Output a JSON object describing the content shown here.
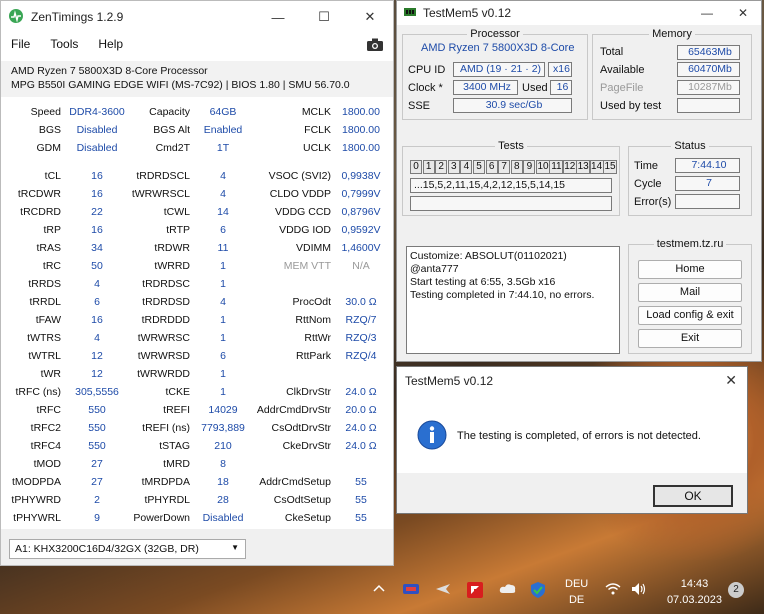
{
  "zen": {
    "title": "ZenTimings 1.2.9",
    "menu": [
      "File",
      "Tools",
      "Help"
    ],
    "cpu": "AMD Ryzen 7 5800X3D 8-Core Processor",
    "board": "MPG B550I GAMING EDGE WIFI (MS-7C92) | BIOS 1.80 | SMU 56.70.0",
    "rows": [
      [
        "Speed",
        "DDR4-3600",
        "Capacity",
        "64GB",
        "MCLK",
        "1800.00"
      ],
      [
        "BGS",
        "Disabled",
        "BGS Alt",
        "Enabled",
        "FCLK",
        "1800.00"
      ],
      [
        "GDM",
        "Disabled",
        "Cmd2T",
        "1T",
        "UCLK",
        "1800.00"
      ],
      null,
      [
        "tCL",
        "16",
        "tRDRDSCL",
        "4",
        "VSOC (SVI2)",
        "0,9938V"
      ],
      [
        "tRCDWR",
        "16",
        "tWRWRSCL",
        "4",
        "CLDO VDDP",
        "0,7999V"
      ],
      [
        "tRCDRD",
        "22",
        "tCWL",
        "14",
        "VDDG CCD",
        "0,8796V"
      ],
      [
        "tRP",
        "16",
        "tRTP",
        "6",
        "VDDG IOD",
        "0,9592V"
      ],
      [
        "tRAS",
        "34",
        "tRDWR",
        "11",
        "VDIMM",
        "1,4600V"
      ],
      [
        "tRC",
        "50",
        "tWRRD",
        "1",
        "MEM VTT",
        "N/A"
      ],
      [
        "tRRDS",
        "4",
        "tRDRDSC",
        "1",
        "",
        ""
      ],
      [
        "tRRDL",
        "6",
        "tRDRDSD",
        "4",
        "ProcOdt",
        "30.0 Ω"
      ],
      [
        "tFAW",
        "16",
        "tRDRDDD",
        "1",
        "RttNom",
        "RZQ/7"
      ],
      [
        "tWTRS",
        "4",
        "tWRWRSC",
        "1",
        "RttWr",
        "RZQ/3"
      ],
      [
        "tWTRL",
        "12",
        "tWRWRSD",
        "6",
        "RttPark",
        "RZQ/4"
      ],
      [
        "tWR",
        "12",
        "tWRWRDD",
        "1",
        "",
        ""
      ],
      [
        "tRFC (ns)",
        "305,5556",
        "tCKE",
        "1",
        "ClkDrvStr",
        "24.0 Ω"
      ],
      [
        "tRFC",
        "550",
        "tREFI",
        "14029",
        "AddrCmdDrvStr",
        "20.0 Ω"
      ],
      [
        "tRFC2",
        "550",
        "tREFI (ns)",
        "7793,889",
        "CsOdtDrvStr",
        "24.0 Ω"
      ],
      [
        "tRFC4",
        "550",
        "tSTAG",
        "210",
        "CkeDrvStr",
        "24.0 Ω"
      ],
      [
        "tMOD",
        "27",
        "tMRD",
        "8",
        "",
        ""
      ],
      [
        "tMODPDA",
        "27",
        "tMRDPDA",
        "18",
        "AddrCmdSetup",
        "55"
      ],
      [
        "tPHYWRD",
        "2",
        "tPHYRDL",
        "28",
        "CsOdtSetup",
        "55"
      ],
      [
        "tPHYWRL",
        "9",
        "PowerDown",
        "Disabled",
        "CkeSetup",
        "55"
      ]
    ],
    "module": "A1: KHX3200C16D4/32GX (32GB, DR)"
  },
  "testmem": {
    "title": "TestMem5 v0.12",
    "processor_legend": "Processor",
    "cpu_name": "AMD Ryzen 7 5800X3D 8-Core",
    "cpu_id_label": "CPU ID",
    "cpu_id": "AMD (19 · 21 · 2)",
    "cpu_threads": "x16",
    "clock_label": "Clock *",
    "clock": "3400 MHz",
    "used_label": "Used",
    "used": "16",
    "sse_label": "SSE",
    "sse": "30.9 sec/Gb",
    "memory_legend": "Memory",
    "total_label": "Total",
    "total": "65463Mb",
    "available_label": "Available",
    "available": "60470Mb",
    "pagefile_label": "PageFile",
    "pagefile": "10287Mb",
    "usedbytest_label": "Used by test",
    "usedbytest": "",
    "tests_legend": "Tests",
    "test_numbers": [
      "0",
      "1",
      "2",
      "3",
      "4",
      "5",
      "6",
      "7",
      "8",
      "9",
      "10",
      "11",
      "12",
      "13",
      "14",
      "15"
    ],
    "test_sequence": "...15,5,2,11,15,4,2,12,15,5,14,15",
    "status_legend": "Status",
    "time_label": "Time",
    "time": "7:44.10",
    "cycle_label": "Cycle",
    "cycle": "7",
    "errors_label": "Error(s)",
    "errors": "",
    "log": [
      "Customize: ABSOLUT(01102021) @anta777",
      "Start testing at 6:55, 3.5Gb x16",
      "Testing completed in 7:44.10, no errors."
    ],
    "site": "testmem.tz.ru",
    "buttons": [
      "Home",
      "Mail",
      "Load config & exit",
      "Exit"
    ]
  },
  "dialog": {
    "title": "TestMem5 v0.12",
    "message": "The testing is completed, of errors is not detected.",
    "ok": "OK"
  },
  "taskbar": {
    "lang1": "DEU",
    "lang2": "DE",
    "time": "14:43",
    "date": "07.03.2023",
    "notifications": "2"
  }
}
